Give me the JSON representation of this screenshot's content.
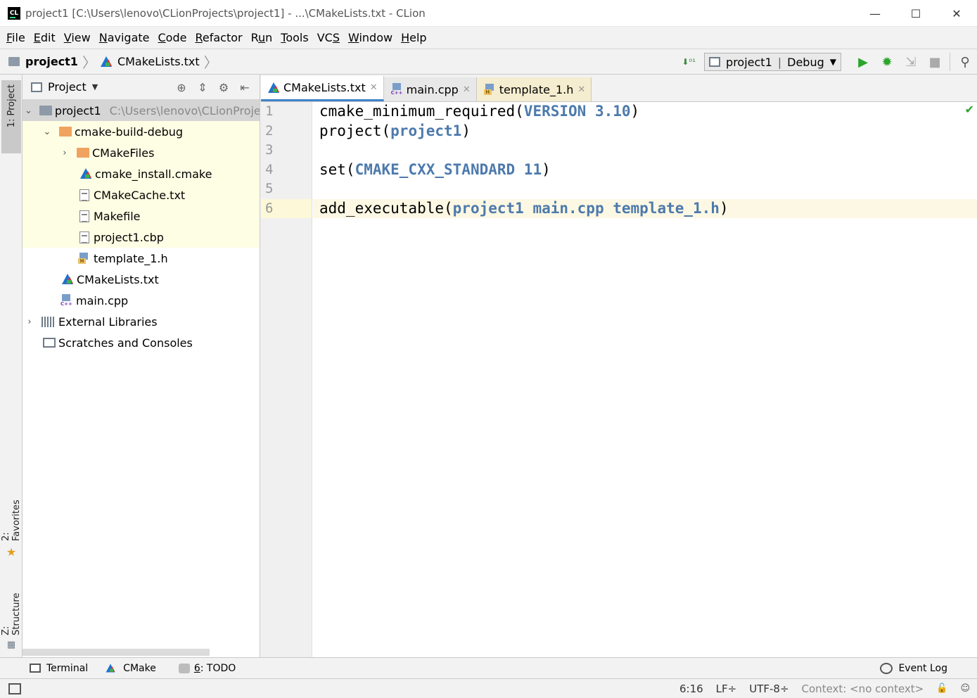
{
  "window": {
    "title": "project1 [C:\\Users\\lenovo\\CLionProjects\\project1] - ...\\CMakeLists.txt - CLion",
    "app_icon_label": "CL",
    "minimize": "—",
    "maximize": "☐",
    "close": "✕"
  },
  "menu": {
    "items": [
      {
        "pre": "",
        "mn": "F",
        "post": "ile"
      },
      {
        "pre": "",
        "mn": "E",
        "post": "dit"
      },
      {
        "pre": "",
        "mn": "V",
        "post": "iew"
      },
      {
        "pre": "",
        "mn": "N",
        "post": "avigate"
      },
      {
        "pre": "",
        "mn": "C",
        "post": "ode"
      },
      {
        "pre": "",
        "mn": "R",
        "post": "efactor"
      },
      {
        "pre": "R",
        "mn": "u",
        "post": "n"
      },
      {
        "pre": "",
        "mn": "T",
        "post": "ools"
      },
      {
        "pre": "VC",
        "mn": "S",
        "post": ""
      },
      {
        "pre": "",
        "mn": "W",
        "post": "indow"
      },
      {
        "pre": "",
        "mn": "H",
        "post": "elp"
      }
    ]
  },
  "navbar": {
    "crumb_project": "project1",
    "crumb_file": "CMakeLists.txt",
    "config_name": "project1",
    "config_type": "Debug"
  },
  "left_stripe": {
    "project_tab": "1: Project",
    "favorites_tab": "2: Favorites",
    "structure_tab": "Z: Structure"
  },
  "project_panel": {
    "title": "Project",
    "tree": {
      "root": "project1",
      "root_path": "C:\\Users\\lenovo\\CLionProjects\\project1",
      "build_dir": "cmake-build-debug",
      "cmakefiles": "CMakeFiles",
      "cmake_install": "cmake_install.cmake",
      "cmakecache": "CMakeCache.txt",
      "makefile": "Makefile",
      "cbp": "project1.cbp",
      "template_h": "template_1.h",
      "cmakelists": "CMakeLists.txt",
      "main_cpp": "main.cpp",
      "external_libs": "External Libraries",
      "scratches": "Scratches and Consoles"
    }
  },
  "editor": {
    "tabs": [
      {
        "label": "CMakeLists.txt"
      },
      {
        "label": "main.cpp"
      },
      {
        "label": "template_1.h"
      }
    ],
    "line_numbers": [
      "1",
      "2",
      "3",
      "4",
      "5",
      "6"
    ],
    "current_line": 6,
    "lines": {
      "l1_fn": "cmake_minimum_required(",
      "l1_arg": "VERSION 3.10",
      "l1_end": ")",
      "l2_fn": "project(",
      "l2_arg": "project1",
      "l2_end": ")",
      "l4_fn": "set(",
      "l4_arg": "CMAKE_CXX_STANDARD 11",
      "l4_end": ")",
      "l6_fn": "add_executable(",
      "l6_arg": "project1 main.cpp template_1.h",
      "l6_end": ")"
    },
    "keyword_color": "#4d7aad"
  },
  "bottom_tools": {
    "terminal": "Terminal",
    "cmake": "CMake",
    "todo_num": "6",
    "todo_label": ": TODO",
    "event_log": "Event Log"
  },
  "status": {
    "position": "6:16",
    "line_sep": "LF÷",
    "encoding": "UTF-8÷",
    "context": "Context: <no context>"
  }
}
